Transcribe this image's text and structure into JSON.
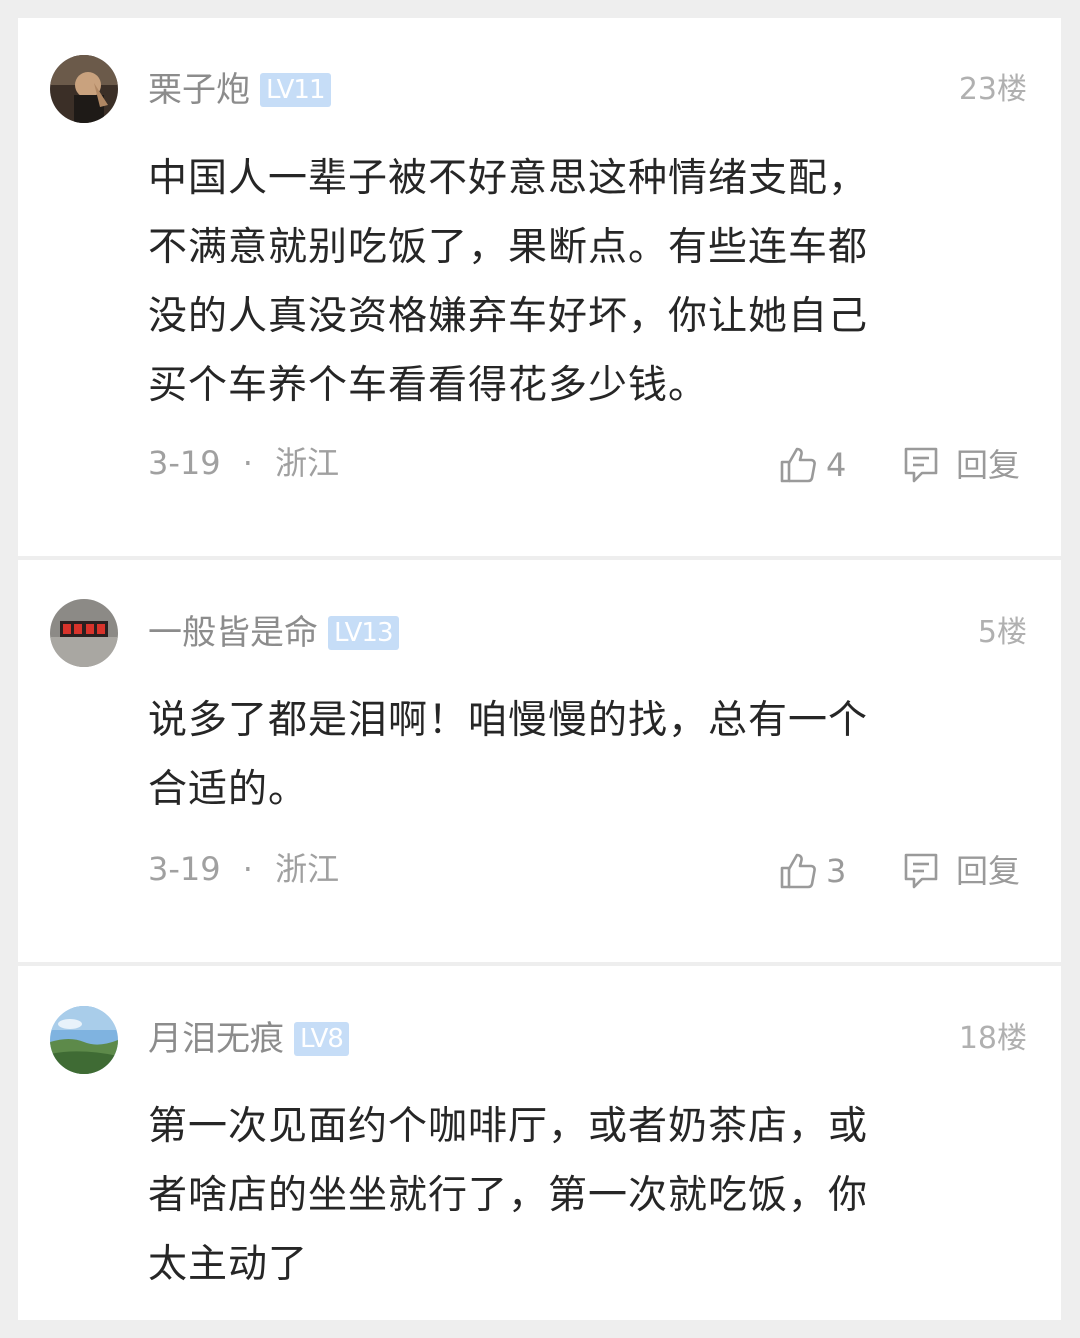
{
  "comments": [
    {
      "username": "栗子炮",
      "level": "LV11",
      "floor": "23楼",
      "lines": [
        "中国人一辈子被不好意思这种情绪支配，",
        "不满意就别吃饭了，果断点。有些连车都",
        "没的人真没资格嫌弃车好坏，你让她自己",
        "买个车养个车看看得花多少钱。"
      ],
      "date": "3-19",
      "separator": "·",
      "location": "浙江",
      "likes": "4",
      "reply_label": "回复"
    },
    {
      "username": "一般皆是命",
      "level": "LV13",
      "floor": "5楼",
      "lines": [
        "说多了都是泪啊！咱慢慢的找，总有一个",
        "合适的。"
      ],
      "date": "3-19",
      "separator": "·",
      "location": "浙江",
      "likes": "3",
      "reply_label": "回复"
    },
    {
      "username": "月泪无痕",
      "level": "LV8",
      "floor": "18楼",
      "lines": [
        "第一次见面约个咖啡厅，或者奶茶店，或",
        "者啥店的坐坐就行了，第一次就吃饭，你",
        "太主动了"
      ]
    }
  ],
  "icons": {
    "like": "thumbs-up-icon",
    "reply": "comment-bubble-icon"
  },
  "colors": {
    "background": "#eeeeee",
    "card": "#ffffff",
    "text": "#262626",
    "muted": "#8c8c8c",
    "level_badge": "#c6ddf7"
  }
}
